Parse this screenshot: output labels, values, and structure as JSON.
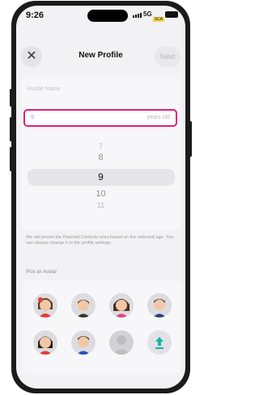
{
  "status": {
    "time": "9:26",
    "network": "5G",
    "network_sub": "SCA"
  },
  "header": {
    "close_icon": "close-icon",
    "title": "New Profile",
    "next_label": "Next"
  },
  "form": {
    "profile_name_placeholder": "Profile Name",
    "age_value": "9",
    "age_unit": "years old",
    "picker_options": [
      "7",
      "8",
      "9",
      "10",
      "11"
    ],
    "picker_selected": "9"
  },
  "hint": "We will preset the Parental Controls rules based on the selected age. You can always change it in the profile settings.",
  "avatars": {
    "label": "Pick an Avatar",
    "items": [
      "avatar-girl-red-bow",
      "avatar-boy-short-hair",
      "avatar-girl-pink-top",
      "avatar-boy-blue-shirt",
      "avatar-girl-bob",
      "avatar-boy-blue-shirt-2",
      "avatar-placeholder-silhouette",
      "upload-icon"
    ]
  },
  "colors": {
    "accent": "#e0207a",
    "upload": "#17b3a6"
  }
}
